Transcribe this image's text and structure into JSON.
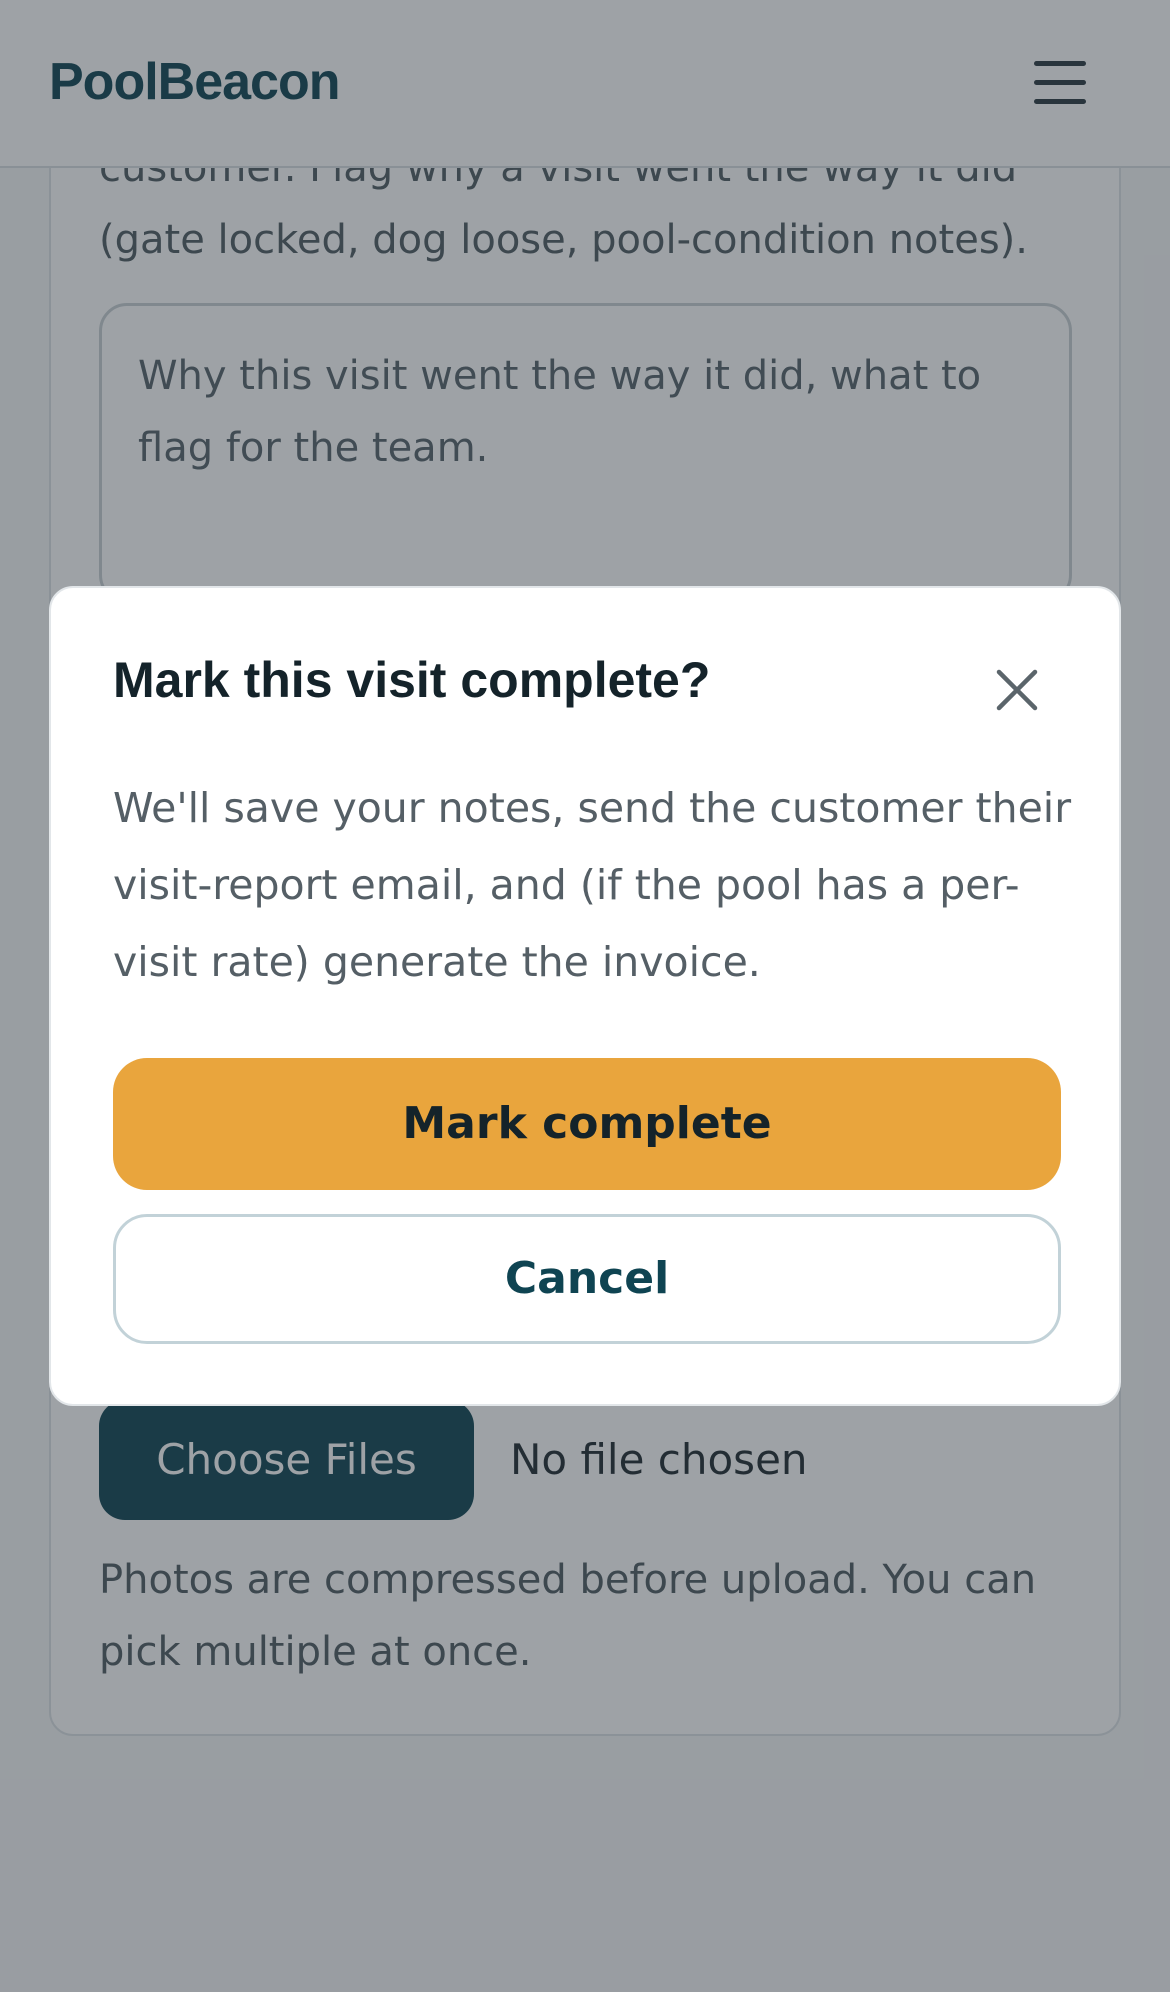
{
  "app": {
    "brand": "PoolBeacon",
    "menu_icon": "hamburger-menu-icon"
  },
  "form": {
    "notes_helper": "customer. Flag why a visit went the way it did (gate locked, dog loose, pool-condition notes).",
    "notes_placeholder": "Why this visit went the way it did, what to flag for the team.",
    "file_button_label": "Choose Files",
    "file_status": "No file chosen",
    "photos_helper": "Photos are compressed before upload. You can pick multiple at once."
  },
  "dialog": {
    "title": "Mark this visit complete?",
    "close_icon": "close-icon",
    "body": "We'll save your notes, send the customer their visit-report email, and (if the pool has a per-visit rate) generate the invoice.",
    "confirm_label": "Mark complete",
    "cancel_label": "Cancel"
  },
  "colors": {
    "brand": "#0f4452",
    "accent": "#e9a53d",
    "overlay": "rgba(40,48,58,0.45)"
  }
}
